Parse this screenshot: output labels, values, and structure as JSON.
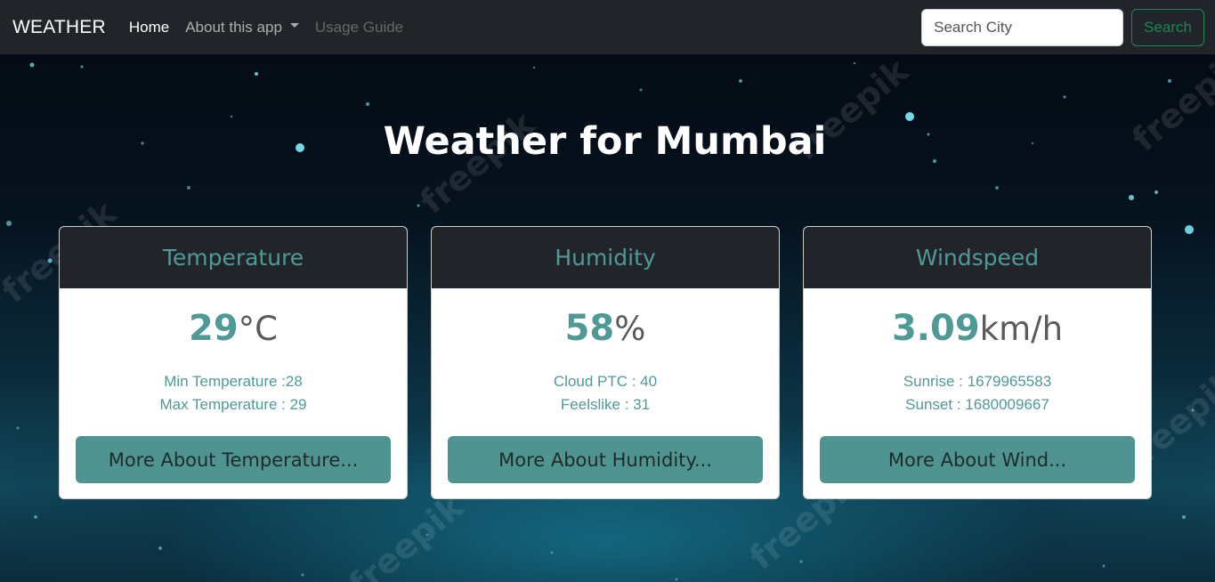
{
  "navbar": {
    "brand": "WEATHER",
    "links": [
      {
        "label": "Home"
      },
      {
        "label": "About this app"
      },
      {
        "label": "Usage Guide"
      }
    ],
    "search_placeholder": "Search City",
    "search_button": "Search"
  },
  "page": {
    "title": "Weather for Mumbai"
  },
  "watermark": "freepik",
  "cards": [
    {
      "header": "Temperature",
      "value": "29",
      "unit": "°C",
      "line1": "Min Temperature :28",
      "line2": "Max Temperature : 29",
      "button": "More About Temperature..."
    },
    {
      "header": "Humidity",
      "value": "58",
      "unit": "%",
      "line1": "Cloud PTC : 40",
      "line2": "Feelslike : 31",
      "button": "More About Humidity..."
    },
    {
      "header": "Windspeed",
      "value": "3.09",
      "unit": "km/h",
      "line1": "Sunrise : 1679965583",
      "line2": "Sunset : 1680009667",
      "button": "More About Wind..."
    }
  ],
  "colors": {
    "navbar_bg": "#212529",
    "accent_teal": "#4f9a96",
    "button_teal": "#4f9490",
    "search_green": "#198754"
  }
}
